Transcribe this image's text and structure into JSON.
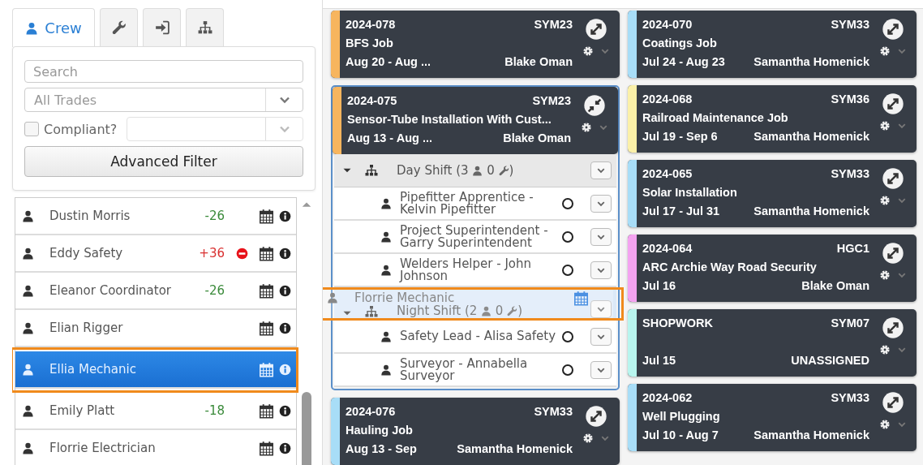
{
  "tabs": [
    {
      "kind": "crew",
      "label": "Crew",
      "selected": true
    },
    {
      "kind": "tools",
      "selected": false
    },
    {
      "kind": "checkin",
      "selected": false
    },
    {
      "kind": "org",
      "selected": false
    }
  ],
  "filters": {
    "search": {
      "placeholder": "Search"
    },
    "trades": {
      "placeholder": "All Trades"
    },
    "compliant": {
      "label": "Compliant?",
      "checked": false
    },
    "advanced_button": "Advanced Filter"
  },
  "crew": [
    {
      "name": "Dustin Morris",
      "hours": "-26",
      "color": "#3a8a3a",
      "blocked": false,
      "selected": false,
      "highlighted": false
    },
    {
      "name": "Eddy Safety",
      "hours": "+36",
      "color": "#d93030",
      "blocked": true,
      "selected": false,
      "highlighted": false
    },
    {
      "name": "Eleanor Coordinator",
      "hours": "-26",
      "color": "#3a8a3a",
      "blocked": false,
      "selected": false,
      "highlighted": false
    },
    {
      "name": "Elian Rigger",
      "blocked": false,
      "selected": false,
      "highlighted": false
    },
    {
      "name": "Ellia Mechanic",
      "blocked": false,
      "selected": true,
      "highlighted": true
    },
    {
      "name": "Emily Platt",
      "hours": "-18",
      "color": "#3a8a3a",
      "blocked": false,
      "selected": false,
      "highlighted": false
    },
    {
      "name": "Florrie Electrician",
      "blocked": false,
      "selected": false,
      "highlighted": false
    }
  ],
  "job_columns": [
    [
      {
        "number": "2024-078",
        "code": "SYM23",
        "title": "BFS Job",
        "dates": "Aug 20 - Aug ...",
        "manager": "Blake Oman",
        "color": "#f7b55e",
        "expanded": false
      },
      {
        "number": "2024-075",
        "code": "SYM23",
        "title": "Sensor-Tube Installation With Cust...",
        "dates": "Aug 13 - Aug ...",
        "manager": "Blake Oman",
        "color": "#f7b55e",
        "expanded": true,
        "shifts": [
          {
            "label_parts": [
              "Day Shift (3",
              "0",
              ")"
            ],
            "drop_target": false,
            "members": [
              "Pipefitter Apprentice - Kelvin Pipefitter",
              "Project Superintendent - Garry Superintendent",
              "Welders Helper - John Johnson"
            ]
          },
          {
            "label_parts": [
              "Night Shift (2",
              "0",
              ")"
            ],
            "drop_target": true,
            "members": [
              "Safety Lead - Alisa Safety",
              "Surveyor - Annabella Surveyor"
            ]
          }
        ]
      },
      {
        "number": "2024-076",
        "code": "SYM33",
        "title": "Hauling Job",
        "dates": "Aug 13 - Sep",
        "manager": "Samantha Homenick",
        "color": "#a8ddf7",
        "expanded": false
      }
    ],
    [
      {
        "number": "2024-070",
        "code": "SYM33",
        "title": "Coatings Job",
        "dates": "Jul 24 - Aug 23",
        "manager": "Samantha Homenick",
        "color": "#a8ddf7",
        "expanded": false
      },
      {
        "number": "2024-068",
        "code": "SYM36",
        "title": "Railroad Maintenance Job",
        "dates": "Jul 19 - Sep 6",
        "manager": "Samantha Homenick",
        "color": "#fbf0a8",
        "expanded": false
      },
      {
        "number": "2024-065",
        "code": "SYM33",
        "title": "Solar Installation",
        "dates": "Jul 17 - Jul 31",
        "manager": "Samantha Homenick",
        "color": "#a8ddf7",
        "expanded": false
      },
      {
        "number": "2024-064",
        "code": "HGC1",
        "title": "ARC Archie Way Road Security",
        "dates": "Jul 16",
        "manager": "Blake Oman",
        "color": "#f4a3f0",
        "expanded": false
      },
      {
        "number": "SHOPWORK",
        "code": "SYM07",
        "dates": "Jul 15",
        "manager": "UNASSIGNED",
        "color": "#b8f5ee",
        "expanded": false
      },
      {
        "number": "2024-062",
        "code": "SYM33",
        "title": "Well Plugging",
        "dates": "Jul 10 - Aug 7",
        "manager": "Samantha Homenick",
        "color": "#a8ddf7",
        "expanded": false
      }
    ]
  ],
  "drag_ghost": {
    "name": "Florrie Mechanic",
    "highlighted": true
  }
}
